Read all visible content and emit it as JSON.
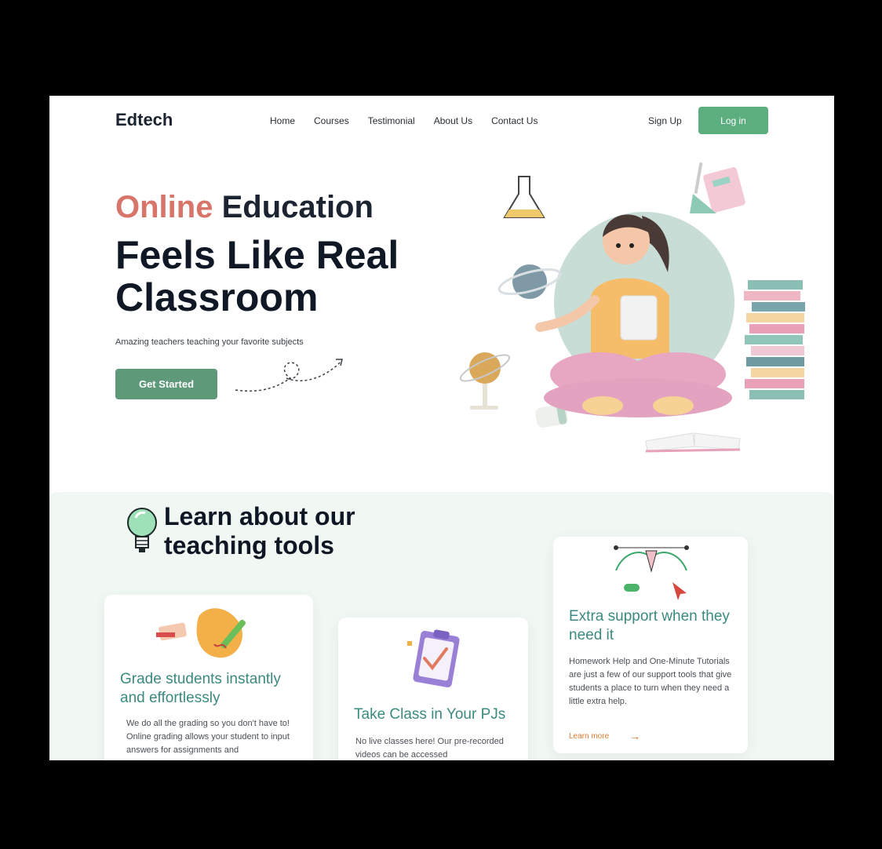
{
  "brand": "Edtech",
  "nav": {
    "items": [
      "Home",
      "Courses",
      "Testimonial",
      "About Us",
      "Contact Us"
    ],
    "signup": "Sign Up",
    "login": "Log in"
  },
  "hero": {
    "title_accent": "Online",
    "title_rest": "Education",
    "headline": "Feels Like Real Classroom",
    "subtitle": "Amazing teachers teaching your favorite subjects",
    "cta": "Get Started"
  },
  "tools": {
    "title": "Learn about our teaching tools",
    "cards": [
      {
        "title": "Grade students instantly and effortlessly",
        "text": "We do all the grading so you don't have to! Online grading allows your student to input answers for assignments and"
      },
      {
        "title": "Take Class in Your PJs",
        "text": "No live classes here! Our pre-recorded videos can be accessed"
      },
      {
        "title": "Extra support when they need it",
        "text": "Homework Help and One-Minute Tutorials are just a few of our support tools that give students a place to turn when they need a little extra help.",
        "link": "Learn more"
      }
    ]
  },
  "colors": {
    "primary_green": "#5cae7f",
    "cta_green": "#5e9a7a",
    "accent_coral": "#d8756a",
    "teal_text": "#3b8a80",
    "link_orange": "#e07b2e",
    "section_bg": "#f1f8f3"
  }
}
